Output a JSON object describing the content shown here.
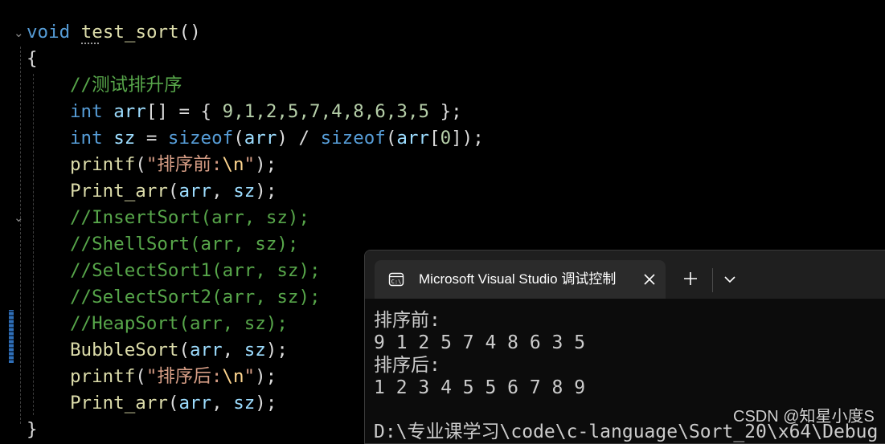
{
  "editor": {
    "signature": {
      "keyword": "void",
      "name": "test_sort",
      "parens": "()"
    },
    "open_brace": "{",
    "close_brace": "}",
    "lines": [
      {
        "comment": "//测试排升序"
      },
      {
        "keyword": "int",
        "var": "arr",
        "rest_a": "[] = { ",
        "numbers": "9,1,2,5,7,4,8,6,3,5",
        "rest_b": " };"
      },
      {
        "keyword": "int",
        "var": "sz",
        "op": " = ",
        "fn1": "sizeof",
        "p1": "(",
        "arg1": "arr",
        "p2": ") / ",
        "fn2": "sizeof",
        "p3": "(",
        "arg2": "arr",
        "p4": "[",
        "num": "0",
        "p5": "]);"
      },
      {
        "fn": "printf",
        "open": "(",
        "str_a": "\"排序前:",
        "esc": "\\n",
        "str_b": "\"",
        "close": ");"
      },
      {
        "fn": "Print_arr",
        "open": "(",
        "a1": "arr",
        "comma": ", ",
        "a2": "sz",
        "close": ");"
      },
      {
        "comment": "//InsertSort(arr, sz);"
      },
      {
        "comment": "//ShellSort(arr, sz);"
      },
      {
        "comment": "//SelectSort1(arr, sz);"
      },
      {
        "comment": "//SelectSort2(arr, sz);"
      },
      {
        "comment": "//HeapSort(arr, sz);"
      },
      {
        "fn": "BubbleSort",
        "open": "(",
        "a1": "arr",
        "comma": ", ",
        "a2": "sz",
        "close": ");"
      },
      {
        "fn": "printf",
        "open": "(",
        "str_a": "\"排序后:",
        "esc": "\\n",
        "str_b": "\"",
        "close": ");"
      },
      {
        "fn": "Print_arr",
        "open": "(",
        "a1": "arr",
        "comma": ", ",
        "a2": "sz",
        "close": ");"
      }
    ]
  },
  "terminal": {
    "tab_title": "Microsoft Visual Studio 调试控制台",
    "output": [
      "排序前:",
      "9 1 2 5 7 4 8 6 3 5",
      "排序后:",
      "1 2 3 4 5 5 6 7 8 9",
      "",
      "D:\\专业课学习\\code\\c-language\\Sort_20\\x64\\Debug"
    ]
  },
  "watermark": "CSDN @知星小度S",
  "colors": {
    "keyword": "#569cd6",
    "function": "#dcdcaa",
    "variable": "#9cdcfe",
    "comment": "#57a64a",
    "string": "#d69d85",
    "number": "#b5cea8",
    "terminal_bg": "#0c0c0c",
    "tab_bg": "#2b2b2b"
  },
  "icons": {
    "tab_icon": "console-window-icon",
    "close": "close-icon",
    "new_tab": "plus-icon",
    "dropdown": "chevron-down-icon",
    "fold": "chevron-down-icon"
  }
}
